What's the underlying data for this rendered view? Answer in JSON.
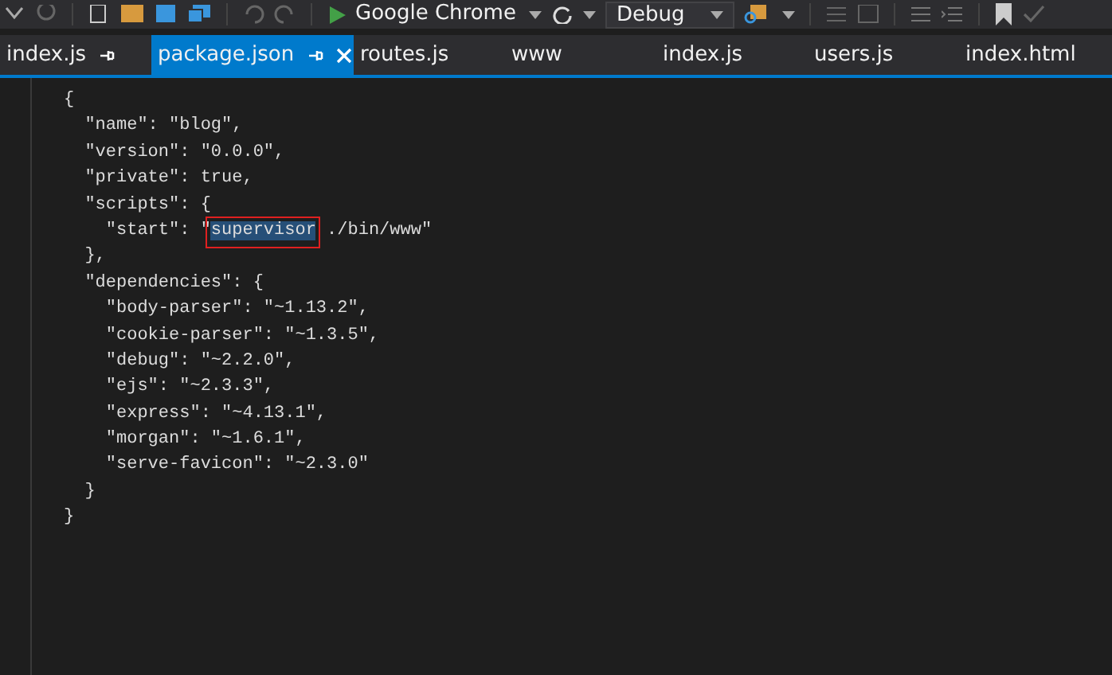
{
  "toolbar": {
    "browser": "Google Chrome",
    "configuration": "Debug"
  },
  "tabs": [
    {
      "label": "index.js",
      "selected": false,
      "pinned": true
    },
    {
      "label": "package.json",
      "selected": true,
      "pinned": true
    },
    {
      "label": "routes.js",
      "selected": false,
      "pinned": false
    },
    {
      "label": "www",
      "selected": false,
      "pinned": false
    },
    {
      "label": "index.js",
      "selected": false,
      "pinned": false
    },
    {
      "label": "users.js",
      "selected": false,
      "pinned": false
    },
    {
      "label": "index.html",
      "selected": false,
      "pinned": false
    }
  ],
  "code_lines": [
    {
      "text": "{"
    },
    {
      "text": "  \"name\": \"blog\","
    },
    {
      "text": "  \"version\": \"0.0.0\","
    },
    {
      "text": "  \"private\": true,"
    },
    {
      "text": "  \"scripts\": {"
    },
    {
      "text": "    \"start\": \"",
      "selection": "supervisor",
      "after": " ./bin/www\"",
      "annotated": true
    },
    {
      "text": "  },"
    },
    {
      "text": "  \"dependencies\": {"
    },
    {
      "text": "    \"body-parser\": \"~1.13.2\","
    },
    {
      "text": "    \"cookie-parser\": \"~1.3.5\","
    },
    {
      "text": "    \"debug\": \"~2.2.0\","
    },
    {
      "text": "    \"ejs\": \"~2.3.3\","
    },
    {
      "text": "    \"express\": \"~4.13.1\","
    },
    {
      "text": "    \"morgan\": \"~1.6.1\","
    },
    {
      "text": "    \"serve-favicon\": \"~2.3.0\""
    },
    {
      "text": "  }"
    },
    {
      "text": "}"
    }
  ]
}
